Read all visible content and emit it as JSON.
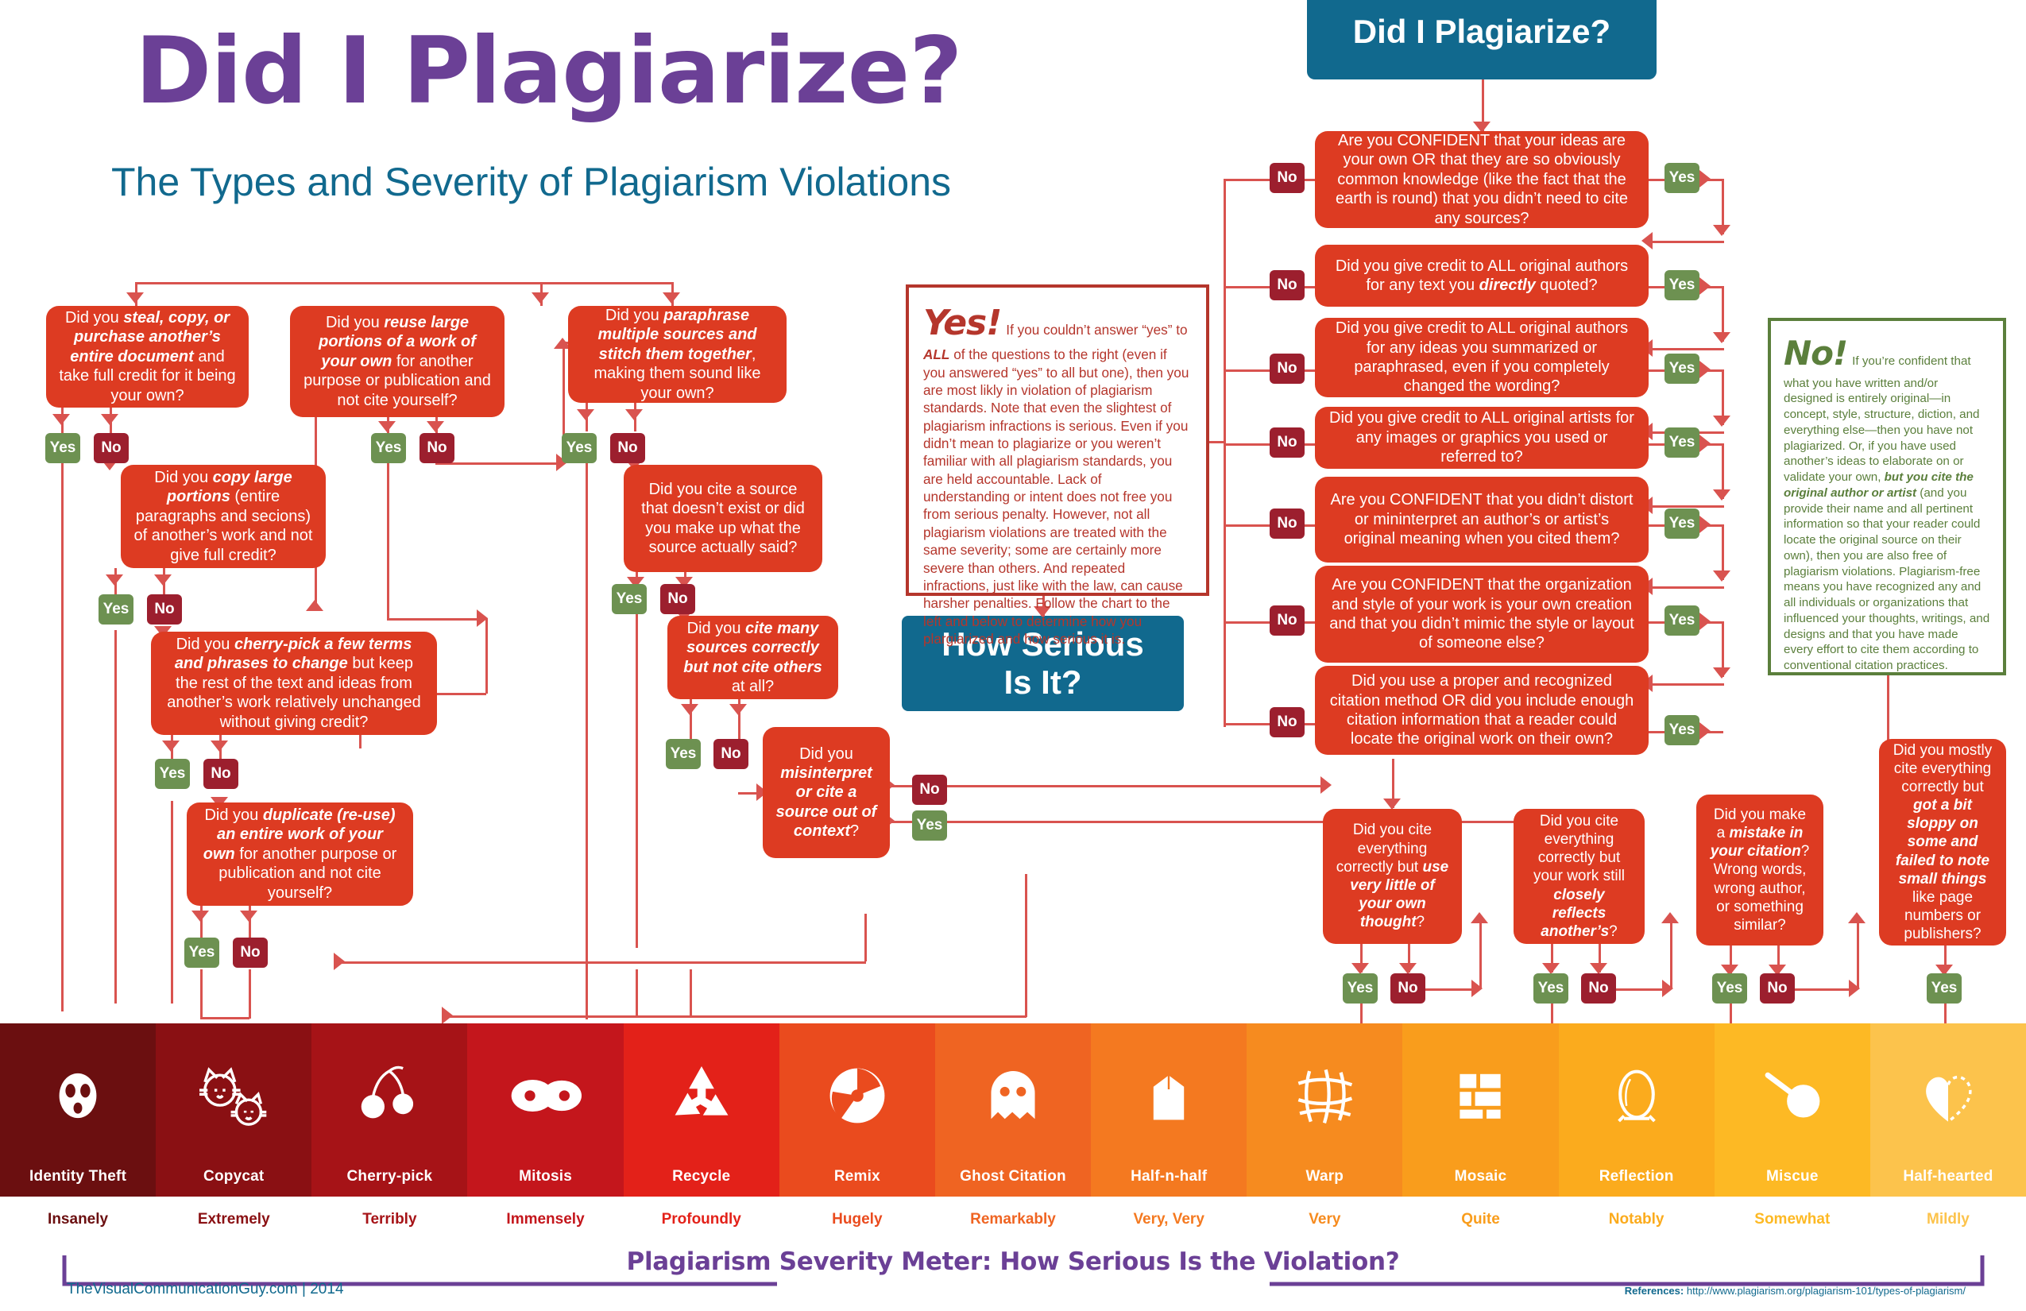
{
  "header": {
    "title": "Did I Plagiarize?",
    "subtitle": "The Types and Severity of Plagiarism Violations",
    "banner_right": "Did I Plagiarize?",
    "banner_serious_line1": "How Serious",
    "banner_serious_line2": "Is It?"
  },
  "labels": {
    "yes": "Yes",
    "no": "No"
  },
  "left_flow": [
    {
      "id": "q-steal",
      "text_parts": [
        {
          "t": "Did you ",
          "b": false
        },
        {
          "t": "steal, copy, or purchase another’s entire document",
          "b": true
        },
        {
          "t": " and take full credit for it being your own?",
          "b": false
        }
      ]
    },
    {
      "id": "q-copy-large",
      "text_parts": [
        {
          "t": "Did you ",
          "b": false
        },
        {
          "t": "copy large portions",
          "b": true
        },
        {
          "t": " (entire paragraphs and secions) of another’s work and not give full credit?",
          "b": false
        }
      ]
    },
    {
      "id": "q-cherry-pick",
      "text_parts": [
        {
          "t": "Did you ",
          "b": false
        },
        {
          "t": "cherry-pick a few terms and phrases to change",
          "b": true
        },
        {
          "t": " but keep the rest of the text and ideas from another’s work relatively unchanged without giving credit?",
          "b": false
        }
      ]
    },
    {
      "id": "q-duplicate",
      "text_parts": [
        {
          "t": "Did you ",
          "b": false
        },
        {
          "t": "duplicate (re-use) an entire work of your own",
          "b": true
        },
        {
          "t": " for another purpose or publication and not cite yourself?",
          "b": false
        }
      ]
    },
    {
      "id": "q-reuse-large",
      "text_parts": [
        {
          "t": "Did you ",
          "b": false
        },
        {
          "t": "reuse large portions of a work of your own",
          "b": true
        },
        {
          "t": " for another purpose or publication and not cite yourself?",
          "b": false
        }
      ]
    },
    {
      "id": "q-paraphrase",
      "text_parts": [
        {
          "t": "Did you ",
          "b": false
        },
        {
          "t": "paraphrase multiple sources and stitch them together",
          "b": true
        },
        {
          "t": ", making them sound like your own?",
          "b": false
        }
      ]
    },
    {
      "id": "q-fake-source",
      "text_parts": [
        {
          "t": "Did you cite a source that doesn’t exist or did you make up what the source actually said?",
          "b": false
        }
      ]
    },
    {
      "id": "q-cite-many",
      "text_parts": [
        {
          "t": "Did you ",
          "b": false
        },
        {
          "t": "cite many sources correctly but not cite others",
          "b": true
        },
        {
          "t": " at all?",
          "b": false
        }
      ]
    },
    {
      "id": "q-misinterpret",
      "text_parts": [
        {
          "t": "Did you ",
          "b": false
        },
        {
          "t": "misinterpret or cite a source out of context",
          "b": true
        },
        {
          "t": "?",
          "b": false
        }
      ]
    }
  ],
  "right_flow": [
    {
      "id": "q-confident-ideas",
      "text_parts": [
        {
          "t": "Are you CONFIDENT that your ideas are your own OR that they are so obviously common knowledge (like the fact that the earth is round) that you didn’t need to cite any sources?",
          "b": false
        }
      ]
    },
    {
      "id": "q-credit-quoted",
      "text_parts": [
        {
          "t": "Did you give credit to ALL original authors for any text you ",
          "b": false
        },
        {
          "t": "directly",
          "b": true
        },
        {
          "t": " quoted?",
          "b": false
        }
      ]
    },
    {
      "id": "q-credit-paraphrased",
      "text_parts": [
        {
          "t": "Did you give credit to ALL original authors for any ideas you summarized or paraphrased, even if you completely changed the wording?",
          "b": false
        }
      ]
    },
    {
      "id": "q-credit-artists",
      "text_parts": [
        {
          "t": "Did you give credit to ALL original artists for any images or graphics you used or referred to?",
          "b": false
        }
      ]
    },
    {
      "id": "q-no-distort",
      "text_parts": [
        {
          "t": "Are you CONFIDENT that you didn’t distort or mininterpret an author’s or artist’s original meaning when you cited them?",
          "b": false
        }
      ]
    },
    {
      "id": "q-own-organization",
      "text_parts": [
        {
          "t": "Are you CONFIDENT that the organization and style of your work is your own creation and that you didn’t mimic the style or layout of someone else?",
          "b": false
        }
      ]
    },
    {
      "id": "q-proper-citation",
      "text_parts": [
        {
          "t": "Did you use a proper and recognized citation method OR did you include enough citation information that a reader could locate the original work on their own?",
          "b": false
        }
      ]
    }
  ],
  "bottom_flow": [
    {
      "id": "q-little-own-thought",
      "text_parts": [
        {
          "t": "Did you cite everything correctly but ",
          "b": false
        },
        {
          "t": "use very little of your own thought",
          "b": true
        },
        {
          "t": "?",
          "b": false
        }
      ]
    },
    {
      "id": "q-closely-reflects",
      "text_parts": [
        {
          "t": "Did you cite everything correctly but your work still ",
          "b": false
        },
        {
          "t": "closely reflects another’s",
          "b": true
        },
        {
          "t": "?",
          "b": false
        }
      ]
    },
    {
      "id": "q-citation-mistake",
      "text_parts": [
        {
          "t": "Did you make a ",
          "b": false
        },
        {
          "t": "mistake in your citation",
          "b": true
        },
        {
          "t": "? Wrong words, wrong author, or something similar?",
          "b": false
        }
      ]
    },
    {
      "id": "q-bit-sloppy",
      "text_parts": [
        {
          "t": "Did you mostly cite everything correctly but ",
          "b": false
        },
        {
          "t": "got a bit sloppy on some and failed to note small things",
          "b": true
        },
        {
          "t": " like page numbers or publishers?",
          "b": false
        }
      ]
    }
  ],
  "yes_callout": {
    "heading": "Yes!",
    "body_1": "If you couldn’t answer “yes” to ",
    "body_em": "ALL",
    "body_2": " of the questions to the right (even if you answered “yes” to all but one), then you are most likly in violation of plagiarism standards. Note that even the slightest of plagiarism infractions is serious. Even if you didn’t mean to plagiarize or you weren’t familiar with all plagiarism standards, you are held accountable. Lack of understanding or intent does not free you from serious penalty. However, not all plagiarism violations are treated with the same severity; some are certainly more severe than others. And repeated infractions, just like with the law, can cause harsher penalties. Follow the chart to the left and below to determine how you plargiarized and how serious it is."
  },
  "no_callout": {
    "heading": "No!",
    "body_1": "If you’re confident that what you have written and/or designed is entirely original—in concept, style, structure, diction, and everything else—then you have not plagiarized. Or, if you have used another’s ideas to elaborate on or validate your own, ",
    "body_em": "but you cite the original author or artist",
    "body_2": " (and you provide their name and all pertinent information so that your reader could locate the original source on their own), then you are also free of plagiarism violations. Plagiarism-free means you have recognized any and all individuals or organizations that influenced your thoughts, writings, and designs and that you have made every effort to cite them according to conventional citation practices."
  },
  "severity_meter": {
    "title": "Plagiarism Severity Meter: How Serious Is the Violation?",
    "columns": [
      {
        "name": "Identity Theft",
        "adverb": "Insanely",
        "color": "#6b0f10",
        "icon": "mask-icon"
      },
      {
        "name": "Copycat",
        "adverb": "Extremely",
        "color": "#8a1013",
        "icon": "cat-icon"
      },
      {
        "name": "Cherry-pick",
        "adverb": "Terribly",
        "color": "#a61317",
        "icon": "cherries-icon"
      },
      {
        "name": "Mitosis",
        "adverb": "Immensely",
        "color": "#c4161c",
        "icon": "cells-icon"
      },
      {
        "name": "Recycle",
        "adverb": "Profoundly",
        "color": "#e32119",
        "icon": "recycle-icon"
      },
      {
        "name": "Remix",
        "adverb": "Hugely",
        "color": "#ea4b1e",
        "icon": "disc-icon"
      },
      {
        "name": "Ghost Citation",
        "adverb": "Remarkably",
        "color": "#ef6422",
        "icon": "ghost-icon"
      },
      {
        "name": "Half-n-half",
        "adverb": "Very, Very",
        "color": "#f47920",
        "icon": "carton-icon"
      },
      {
        "name": "Warp",
        "adverb": "Very",
        "color": "#f68b1f",
        "icon": "warp-grid-icon"
      },
      {
        "name": "Mosaic",
        "adverb": "Quite",
        "color": "#f99d1c",
        "icon": "mosaic-icon"
      },
      {
        "name": "Reflection",
        "adverb": "Notably",
        "color": "#fbab1d",
        "icon": "mirror-icon"
      },
      {
        "name": "Miscue",
        "adverb": "Somewhat",
        "color": "#fdb924",
        "icon": "cue-ball-icon"
      },
      {
        "name": "Half-hearted",
        "adverb": "Mildly",
        "color": "#fcc34c",
        "icon": "half-heart-icon"
      }
    ]
  },
  "footer": {
    "credit": "TheVisualCommunicationGuy.com | 2014",
    "references_label": "References:",
    "references_url": "http://www.plagiarism.org/plagiarism-101/types-of-plagiarism/"
  }
}
